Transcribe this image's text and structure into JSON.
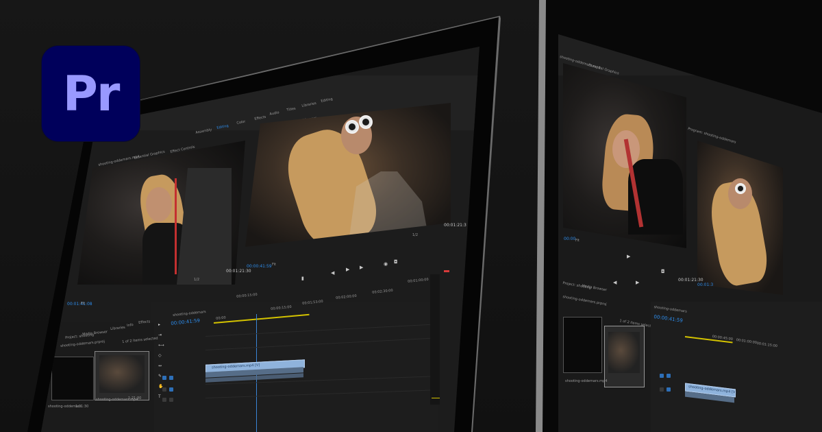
{
  "app": {
    "logo_text": "Pr",
    "logo_bg": "#00005b",
    "logo_fg": "#9999ff",
    "accent": "#2d8ceb"
  },
  "left_monitor": {
    "workspace_tabs": [
      "Assembly",
      "Editing",
      "Color",
      "Effects",
      "Audio",
      "Titles",
      "Libraries",
      "Editing"
    ],
    "source_panel_tabs": [
      "shooting-oddemars.mp4",
      "Essential Graphics",
      "Effect Controls",
      "Audio Track Mixer: shooting-oddemars",
      "Metadata"
    ],
    "program_title": "Program: shooting-oddemars",
    "source_timecode_left": "00:01:41:08",
    "source_timecode_right": "00:01:21:30",
    "program_timecode_left": "00:00:41:59",
    "program_timecode_right": "00:01:21:3",
    "fit_label": "Fit",
    "zoom_label": "1/2",
    "ruler_labels": [
      "00:00:15:00",
      "00:00:30:00",
      "00:00:45:00",
      "00:01:00:00"
    ],
    "timeline_tab": "shooting-oddemars",
    "timeline_timecode": "00:00:41:59",
    "timeline_ruler": [
      "00:00",
      "00:00:15:00",
      "00:01:53:00",
      "00:02:00:00",
      "00:02:30:00"
    ],
    "project_tabs": [
      "Project: shooting",
      "Media Browser",
      "Libraries",
      "Info",
      "Effects"
    ],
    "project_name": "shooting-oddemars.prproj",
    "selection_count": "1 of 2 items selected",
    "clip_name": "shooting-oddemars.mp4",
    "clip_duration": "1:21:30",
    "sequence_name": "shooting-oddemars",
    "sequence_duration": "1:21:30",
    "track_clip_label": "shooting-oddemars.mp4 [V]",
    "track_labels": [
      "V3",
      "V2",
      "V1",
      "A1",
      "A2",
      "A3"
    ]
  },
  "right_monitor": {
    "workspace_tabs": [
      "shooting-oddemars.mp4",
      "Essential Graphics",
      "Effect Controls",
      "Audio Track Mixer: shooting-oddemars",
      "Metadata"
    ],
    "program_title": "Program: shooting-oddemars",
    "source_timecode": "00:00",
    "program_timecode": "00:01:21:30",
    "program_timecode_right": "00:01:3",
    "fit_label": "Fit",
    "timeline_tab": "shooting-oddemars",
    "timeline_timecode": "00:00:41:59",
    "project_tabs": [
      "Project: shooting",
      "Media Browser",
      "Libraries",
      "Info",
      "Effects"
    ],
    "project_name": "shooting-oddemars.prproj",
    "selection_count": "1 of 2 items selected",
    "clip_name": "shooting-oddemars.mp4",
    "track_clip_label": "shooting-oddemars.mp4 [V]",
    "ruler": [
      "00:00:45:00",
      "00:01:00:00",
      "00:01:15:00"
    ]
  }
}
